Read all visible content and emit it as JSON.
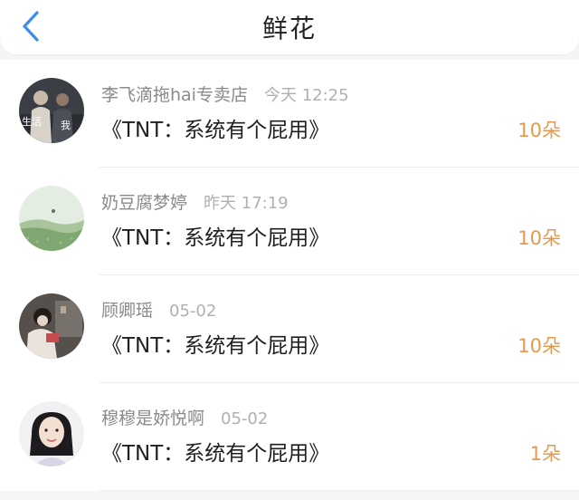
{
  "header": {
    "title": "鲜花",
    "back_icon": "chevron-left-icon",
    "accent": "#3a8ee6"
  },
  "flowers": [
    {
      "name": "李飞滴拖hai专卖店",
      "time": "今天 12:25",
      "book": "《TNT：系统有个屁用》",
      "count": "10朵",
      "avatar_text_left": "生活",
      "avatar_text_right": "我"
    },
    {
      "name": "奶豆腐梦婷",
      "time": "昨天 17:19",
      "book": "《TNT：系统有个屁用》",
      "count": "10朵"
    },
    {
      "name": "顾卿瑶",
      "time": "05-02",
      "book": "《TNT：系统有个屁用》",
      "count": "10朵"
    },
    {
      "name": "穆穆是娇悦啊",
      "time": "05-02",
      "book": "《TNT：系统有个屁用》",
      "count": "1朵"
    }
  ],
  "colors": {
    "count": "#e69a4c",
    "name": "#8a8a8a",
    "time": "#b0b0b0"
  }
}
